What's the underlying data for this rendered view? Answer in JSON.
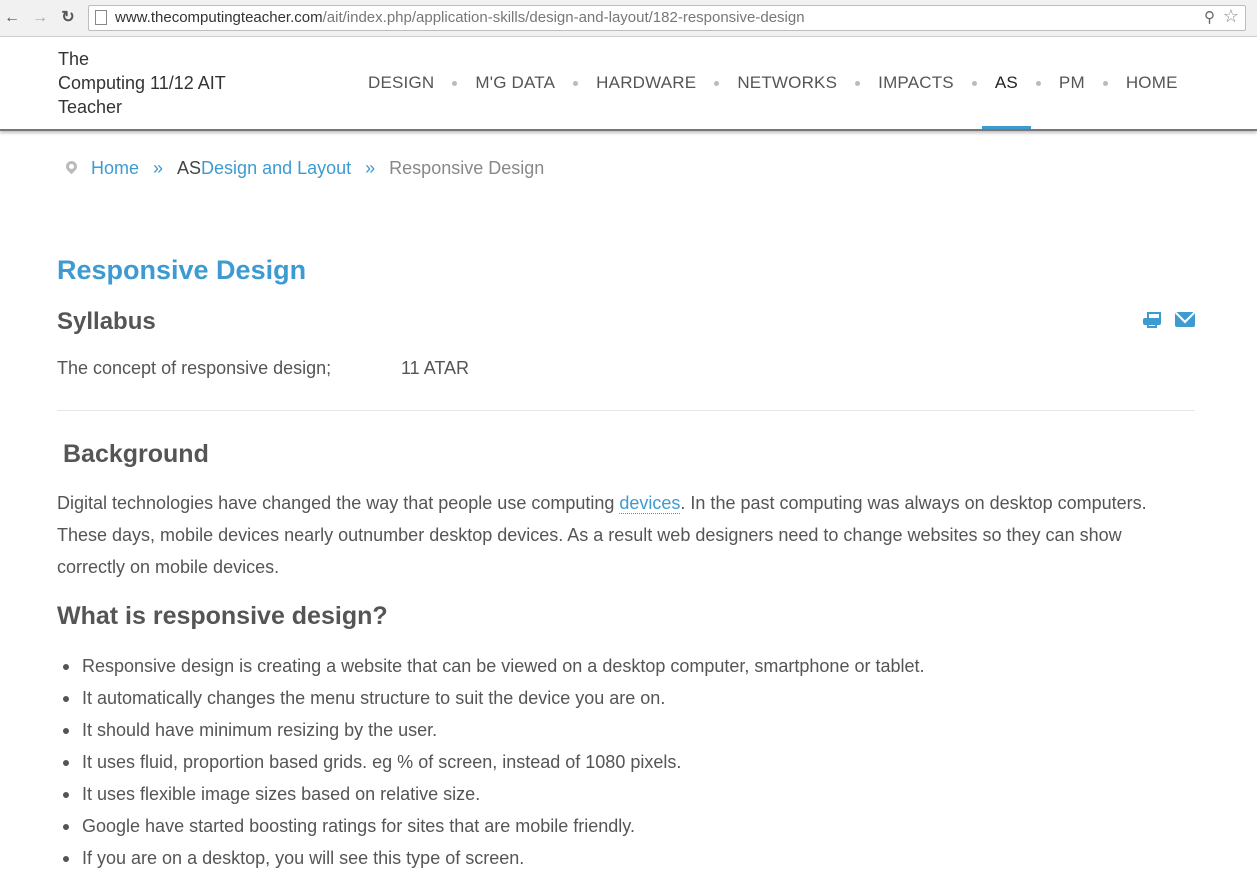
{
  "browser": {
    "url_domain": "www.thecomputingteacher.com",
    "url_path": "/ait/index.php/application-skills/design-and-layout/182-responsive-design"
  },
  "site": {
    "logo_line1": "The",
    "logo_line2": "Computing  11/12 AIT",
    "logo_line3": "Teacher",
    "menu": [
      "DESIGN",
      "M'G DATA",
      "HARDWARE",
      "NETWORKS",
      "IMPACTS",
      "AS",
      "PM",
      "HOME"
    ],
    "active_menu": "AS"
  },
  "breadcrumb": {
    "home": "Home",
    "section_prefix": "AS",
    "section": "Design and Layout",
    "current": "Responsive Design"
  },
  "article": {
    "title": "Responsive Design",
    "syllabus_heading": "Syllabus",
    "syllabus_item": "The concept of responsive design;",
    "syllabus_level": "11 ATAR",
    "background_heading": "Background",
    "background_text_1": "Digital technologies have changed the way that people use computing ",
    "background_link": "devices",
    "background_text_2": ". In the past computing was always on desktop computers. These days, mobile devices nearly outnumber desktop devices. As a result web designers need to change websites so they can show correctly on mobile devices.",
    "what_heading": "What is responsive design?",
    "bullets": [
      "Responsive design is creating a website that can be viewed on a desktop computer, smartphone or tablet.",
      "It automatically changes the menu structure to suit the device you are on.",
      "It should have minimum resizing by the user.",
      "It uses fluid, proportion based grids. eg % of screen, instead of 1080 pixels.",
      "It uses flexible image sizes based on relative size.",
      "Google have started boosting ratings for sites that are mobile friendly.",
      "If you are on a desktop, you will see this type of screen."
    ]
  },
  "colors": {
    "accent": "#3d9bd1",
    "text": "#555555"
  }
}
